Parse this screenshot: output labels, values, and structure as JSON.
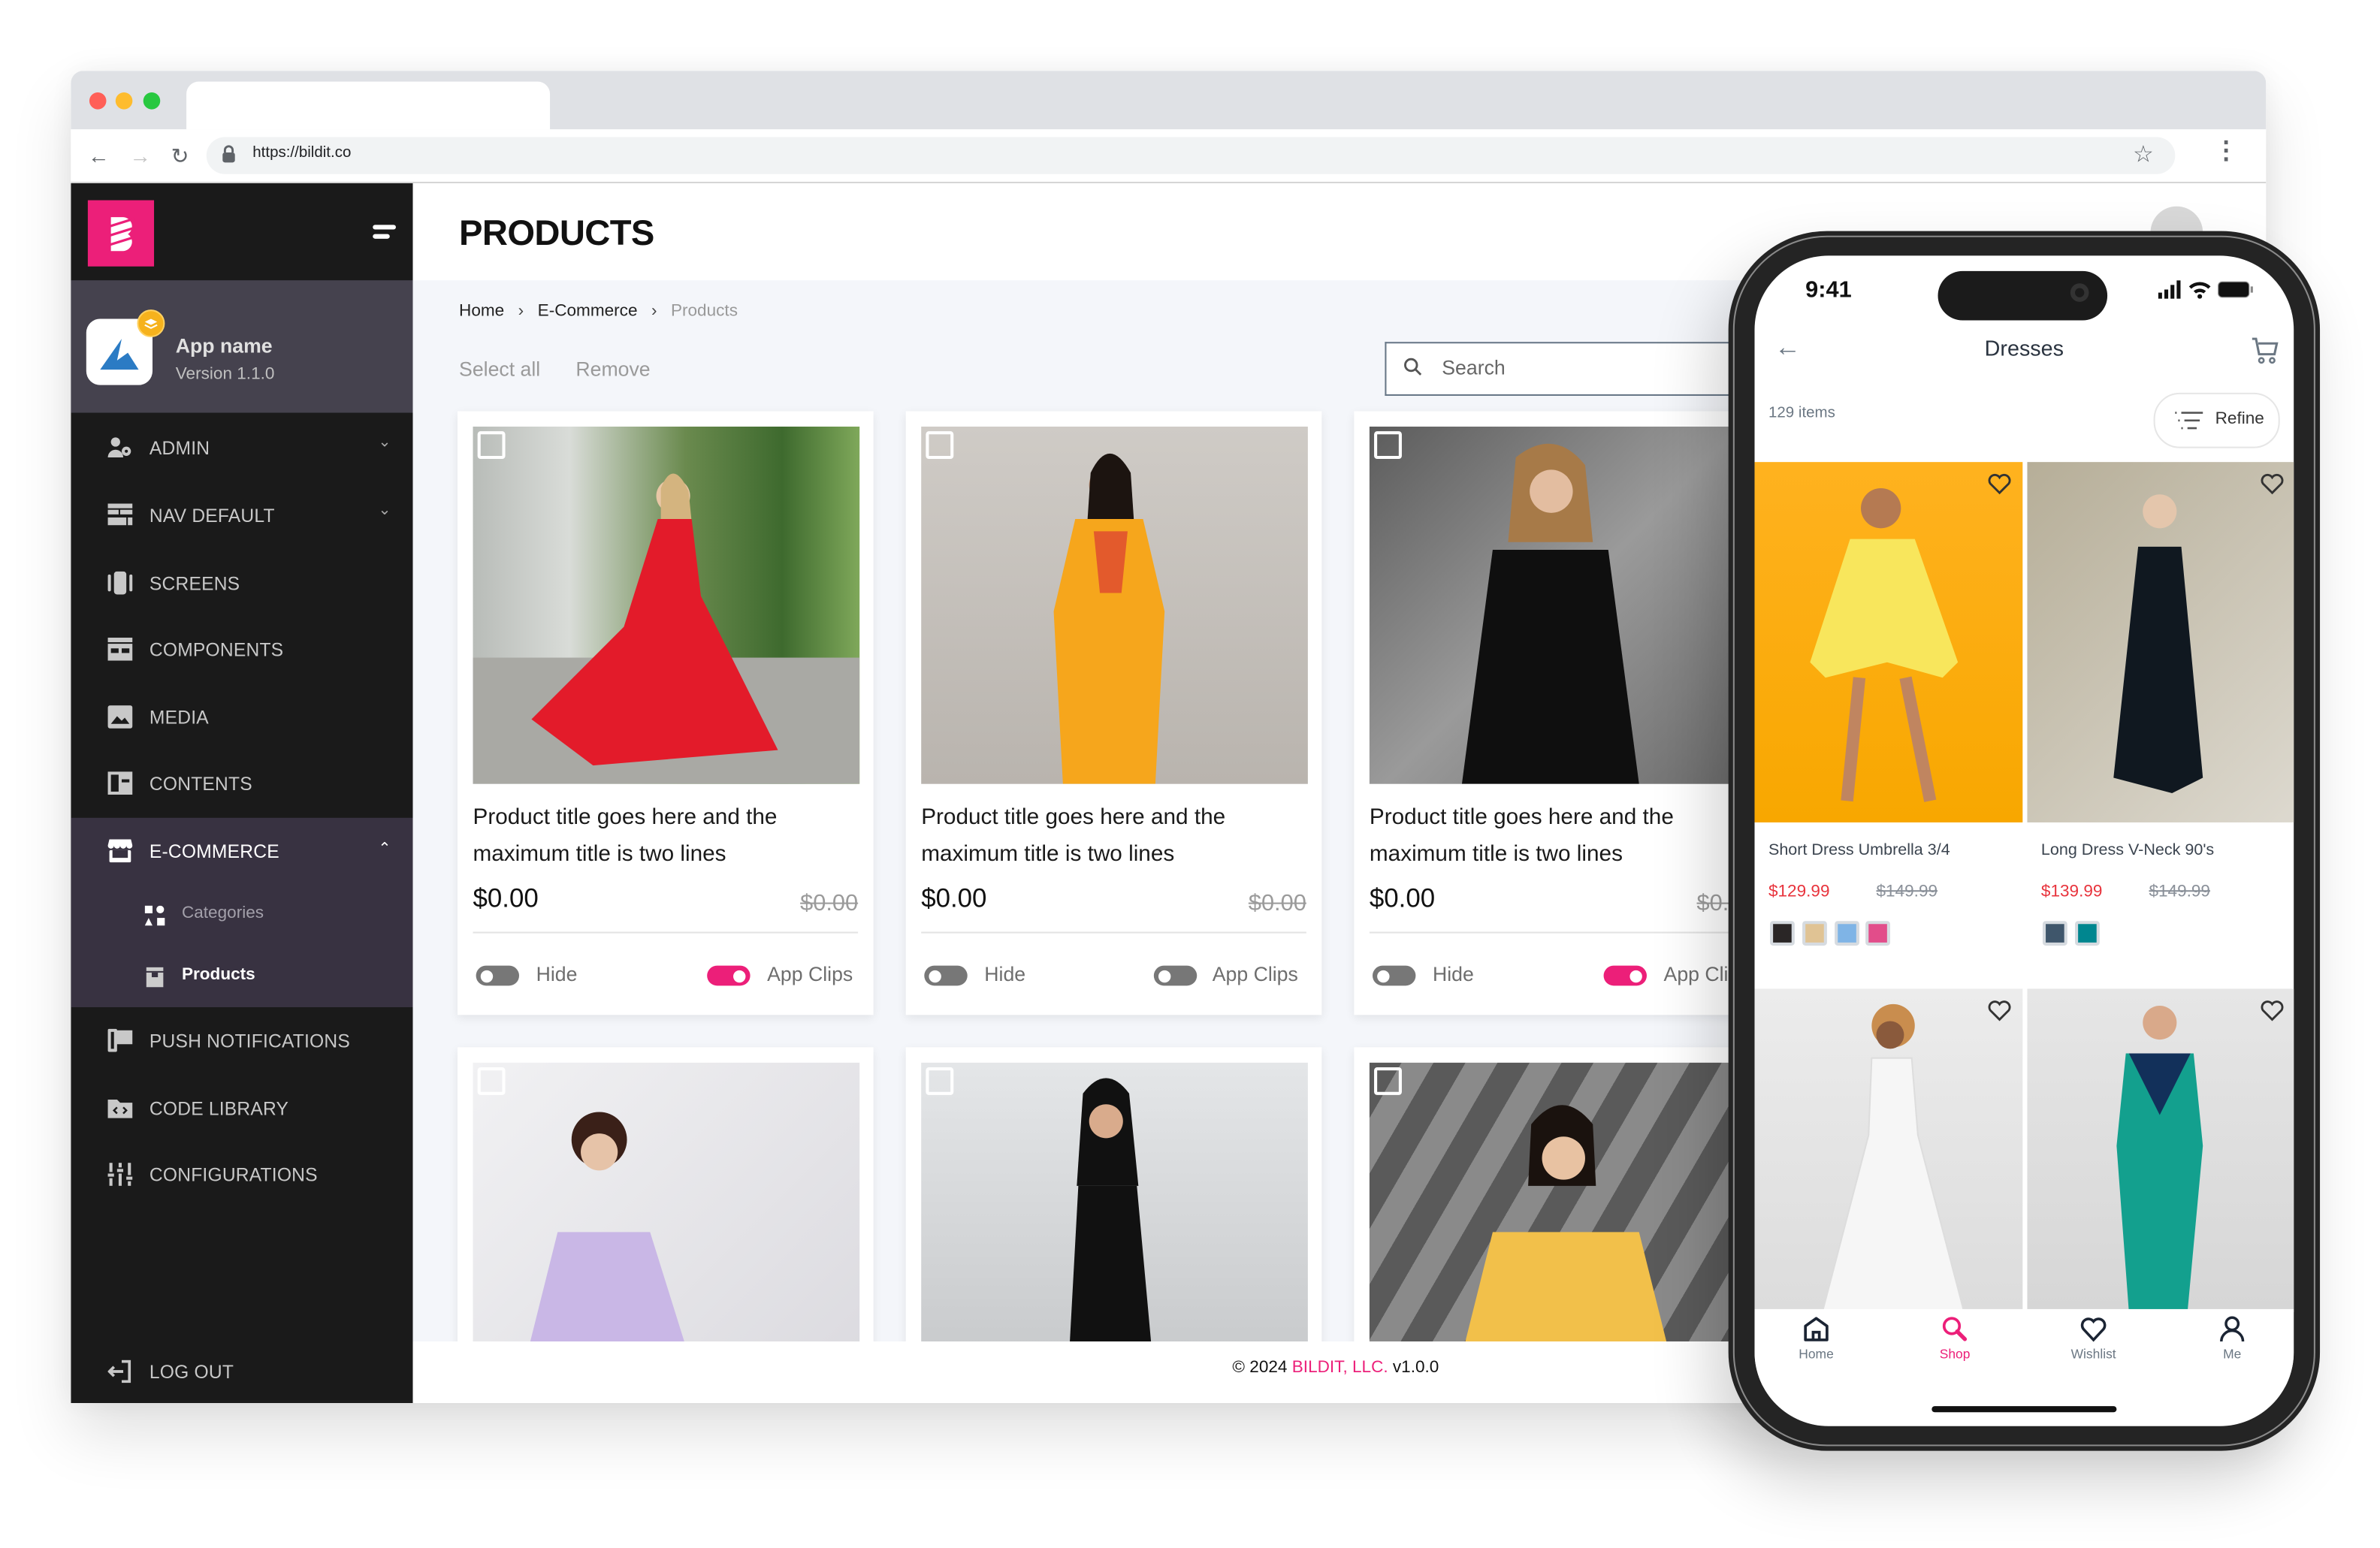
{
  "browser": {
    "url": "https://bildit.co",
    "traffic_lights": {
      "close": "#ff5f57",
      "minimize": "#febc2e",
      "maximize": "#28c840"
    },
    "icons": [
      "back-icon",
      "forward-icon",
      "reload-icon",
      "lock-icon",
      "star-icon",
      "kebab-menu-icon"
    ]
  },
  "colors": {
    "brand": "#ec1f79",
    "sidebar_bg": "#1a1a1a",
    "sidebar_active_group": "#383241",
    "app_block": "#45424e",
    "price_red": "#e8333c"
  },
  "sidebar": {
    "app": {
      "name": "App name",
      "version": "Version 1.1.0"
    },
    "items": [
      {
        "label": "ADMIN",
        "icon": "user-gear-icon",
        "expandable": true,
        "expanded": false
      },
      {
        "label": "NAV DEFAULT",
        "icon": "nav-layout-icon",
        "expandable": true,
        "expanded": false
      },
      {
        "label": "SCREENS",
        "icon": "screens-icon"
      },
      {
        "label": "COMPONENTS",
        "icon": "components-icon"
      },
      {
        "label": "MEDIA",
        "icon": "image-icon"
      },
      {
        "label": "CONTENTS",
        "icon": "contents-icon"
      },
      {
        "label": "E-COMMERCE",
        "icon": "storefront-icon",
        "expandable": true,
        "expanded": true,
        "children": [
          {
            "label": "Categories",
            "icon": "categories-icon",
            "active": false
          },
          {
            "label": "Products",
            "icon": "box-icon",
            "active": true
          }
        ]
      },
      {
        "label": "PUSH NOTIFICATIONS",
        "icon": "push-notification-icon"
      },
      {
        "label": "CODE LIBRARY",
        "icon": "code-folder-icon"
      },
      {
        "label": "CONFIGURATIONS",
        "icon": "sliders-icon"
      }
    ],
    "logout": "LOG OUT"
  },
  "main": {
    "title": "PRODUCTS",
    "breadcrumb": [
      "Home",
      "E-Commerce",
      "Products"
    ],
    "actions": {
      "select_all": "Select all",
      "remove": "Remove"
    },
    "search": {
      "placeholder": "Search",
      "value": ""
    },
    "products": [
      {
        "title": "Product title goes here and the maximum title is two lines",
        "price": "$0.00",
        "old_price": "$0.00",
        "hide": false,
        "app_clips": true,
        "hide_label": "Hide",
        "app_clips_label": "App Clips"
      },
      {
        "title": "Product title goes here and the maximum title is two lines",
        "price": "$0.00",
        "old_price": "$0.00",
        "hide": false,
        "app_clips": false,
        "hide_label": "Hide",
        "app_clips_label": "App Clips"
      },
      {
        "title": "Product title goes here and the maximum title is two lines",
        "price": "$0.00",
        "old_price": "$0.00",
        "hide": false,
        "app_clips": true,
        "hide_label": "Hide",
        "app_clips_label": "App Clips"
      }
    ],
    "footer": {
      "copyright": "© 2024",
      "company": "BILDIT, LLC.",
      "version": "v1.0.0"
    }
  },
  "phone": {
    "status": {
      "time": "9:41"
    },
    "header": {
      "title": "Dresses"
    },
    "count": "129 items",
    "refine": "Refine",
    "products": [
      {
        "title": "Short Dress Umbrella 3/4",
        "price": "$129.99",
        "old_price": "$149.99",
        "swatches": [
          "#2a2626",
          "#e0c394",
          "#7fb4e6",
          "#e24d8a"
        ]
      },
      {
        "title": "Long Dress V-Neck 90's",
        "price": "$139.99",
        "old_price": "$149.99",
        "swatches": [
          "#3f566b",
          "#00868f"
        ]
      }
    ],
    "tabs": [
      {
        "label": "Home",
        "icon": "home-icon",
        "active": false
      },
      {
        "label": "Shop",
        "icon": "shop-search-icon",
        "active": true
      },
      {
        "label": "Wishlist",
        "icon": "heart-icon",
        "active": false
      },
      {
        "label": "Me",
        "icon": "user-icon",
        "active": false
      }
    ]
  }
}
